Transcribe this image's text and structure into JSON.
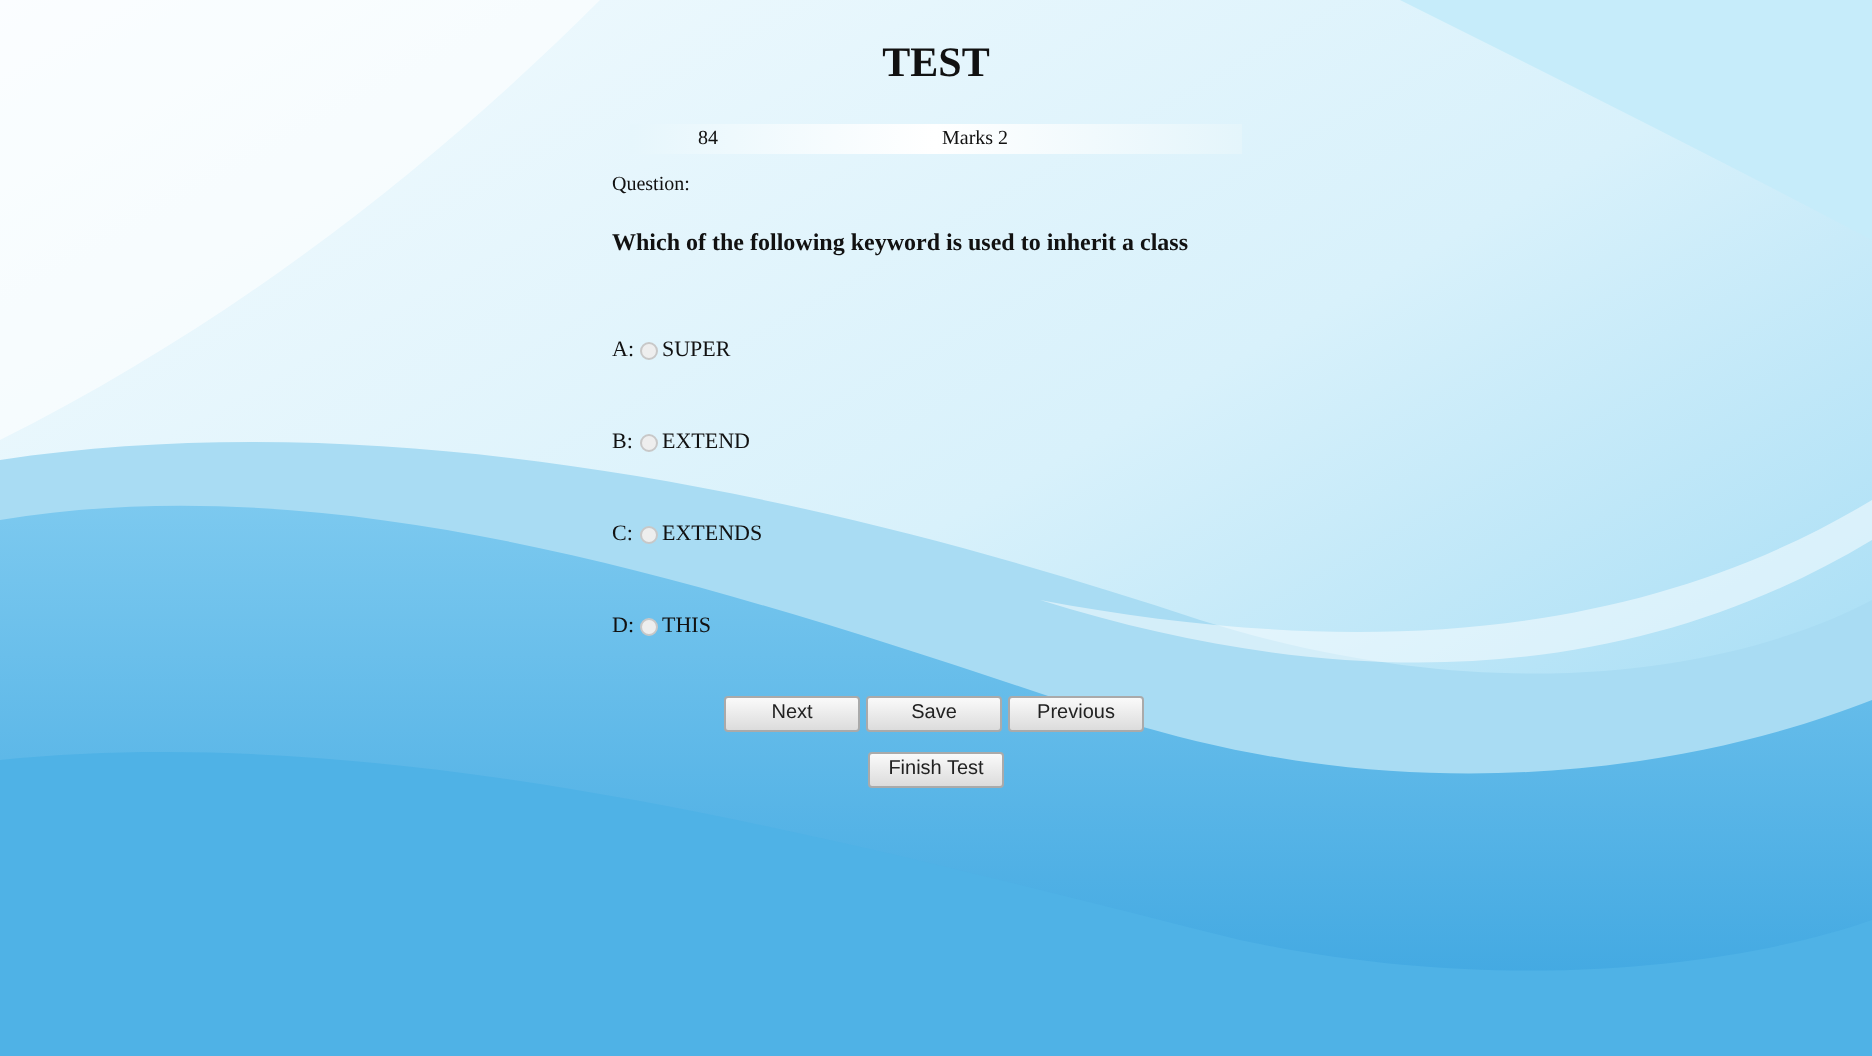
{
  "title": "TEST",
  "info": {
    "number": "84",
    "marks": "Marks 2"
  },
  "question_label": "Question:",
  "question": "Which of the following keyword is used to inherit a class",
  "options": [
    {
      "letter": "A:",
      "text": "SUPER",
      "selected": false
    },
    {
      "letter": "B:",
      "text": "EXTEND",
      "selected": false
    },
    {
      "letter": "C:",
      "text": "EXTENDS",
      "selected": false
    },
    {
      "letter": "D:",
      "text": "THIS",
      "selected": false
    }
  ],
  "buttons": [
    "Next",
    "Save",
    "Previous"
  ],
  "finish_button": "Finish Test"
}
